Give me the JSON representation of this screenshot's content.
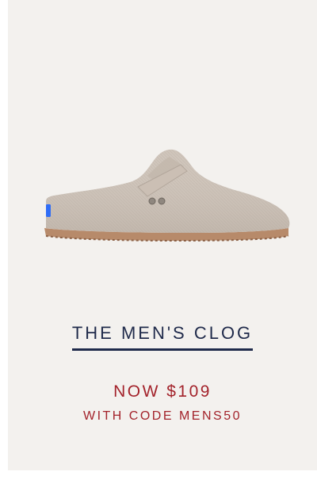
{
  "product": {
    "image_name": "clog-shoe-image",
    "title": "THE MEN'S CLOG",
    "price": "NOW $109",
    "promo": "WITH CODE MENS50"
  },
  "colors": {
    "background": "#f3f1ee",
    "title": "#1f2a4a",
    "accent": "#a3232b",
    "shoe_upper": "#cfc5bb",
    "shoe_sole": "#b78a6a",
    "heel_tab": "#2f6df6"
  }
}
